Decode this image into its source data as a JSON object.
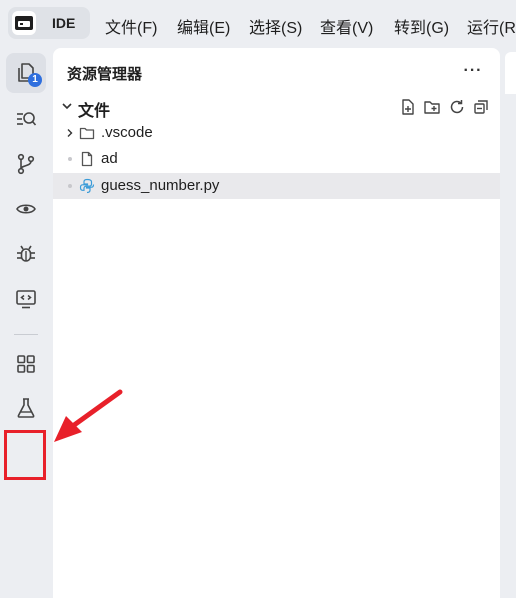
{
  "menubar": {
    "brand_label": "IDE",
    "items": [
      "文件(F)",
      "编辑(E)",
      "选择(S)",
      "查看(V)",
      "转到(G)",
      "运行(R"
    ]
  },
  "activity_bar": {
    "items": [
      {
        "icon": "explorer-files-icon",
        "active": true,
        "badge": "1"
      },
      {
        "icon": "search-icon",
        "active": false
      },
      {
        "icon": "source-control-icon",
        "active": false
      },
      {
        "icon": "preview-eye-icon",
        "active": false
      },
      {
        "icon": "debug-bug-icon",
        "active": false
      },
      {
        "icon": "remote-explorer-icon",
        "active": false
      },
      {
        "icon": "extensions-grid-icon",
        "active": false
      },
      {
        "icon": "testing-flask-icon",
        "active": false
      }
    ]
  },
  "explorer": {
    "title": "资源管理器",
    "more_label": "···",
    "section_label": "文件",
    "section_actions": [
      "new-file-icon",
      "new-folder-icon",
      "refresh-icon",
      "collapse-all-icon"
    ],
    "tree": [
      {
        "label": ".vscode",
        "kind": "folder",
        "selected": false
      },
      {
        "label": "ad",
        "kind": "file",
        "selected": false
      },
      {
        "label": "guess_number.py",
        "kind": "python",
        "selected": true
      }
    ]
  },
  "colors": {
    "accent_badge": "#2f6fde",
    "annotation_red": "#e8202a",
    "selected_row": "#e9e9ec",
    "python_icon": "#3a9bd8"
  }
}
